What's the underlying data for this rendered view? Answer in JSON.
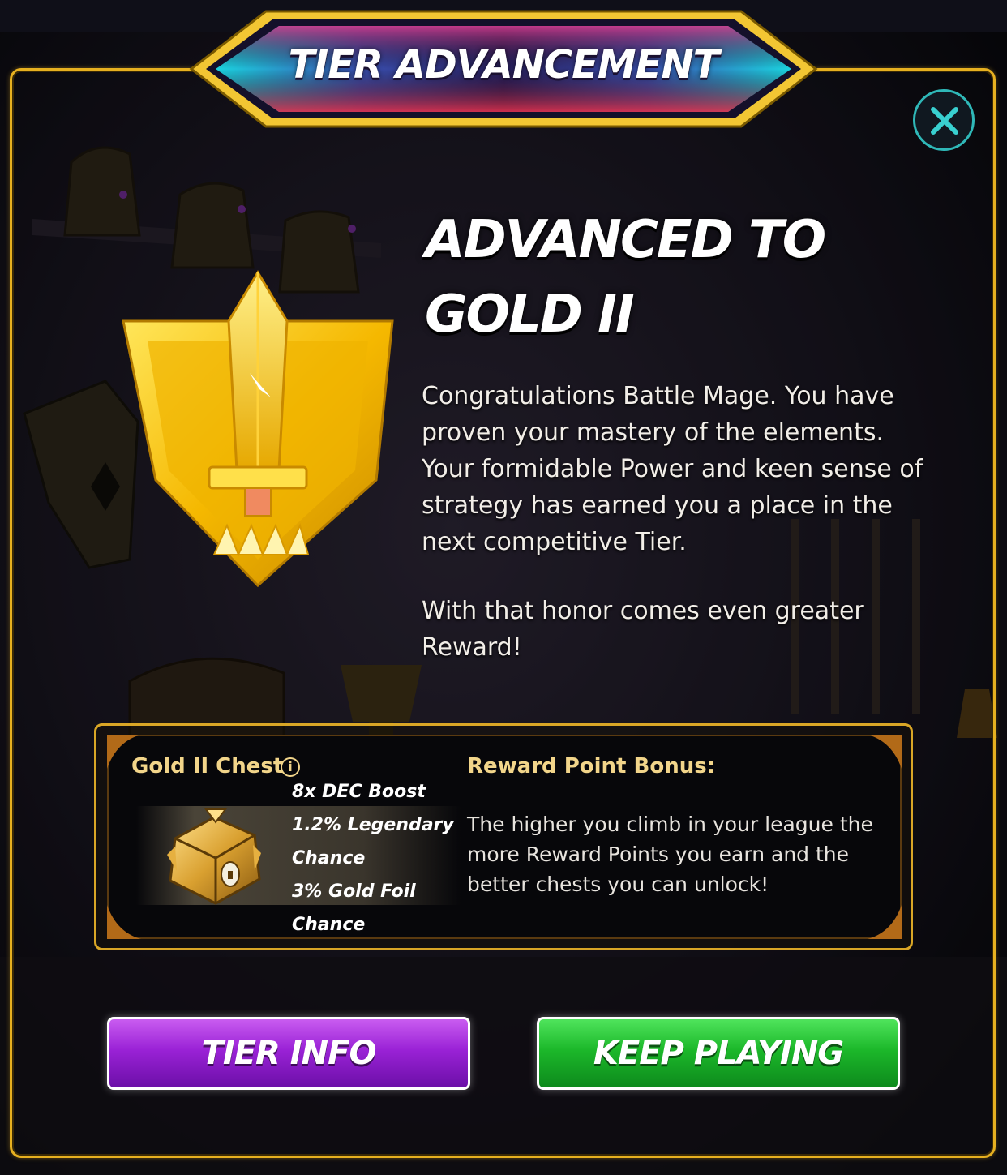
{
  "header": {
    "title": "TIER ADVANCEMENT"
  },
  "close": {
    "icon": "close-icon"
  },
  "heading": {
    "line1": "ADVANCED TO",
    "line2": "GOLD II"
  },
  "message": {
    "paragraph1": "Congratulations Battle Mage. You have proven your mastery of the elements. Your formidable Power and keen sense of strategy has earned you a place in the next competitive Tier.",
    "paragraph2": "With that honor comes even greater Reward!"
  },
  "badge": {
    "icon": "gold-tier-sword-shield-icon"
  },
  "reward": {
    "chest_label": "Gold II Chest",
    "info_icon": "info-icon",
    "chest_icon": "gold-chest-icon",
    "perks": [
      "8x DEC Boost",
      "1.2% Legendary",
      "Chance",
      "3% Gold Foil",
      "Chance"
    ],
    "bonus_title": "Reward Point Bonus:",
    "bonus_text": "The higher you climb in your league the more Reward Points you earn and the better chests you can unlock!"
  },
  "buttons": {
    "tier_info": "TIER INFO",
    "keep_playing": "KEEP PLAYING"
  },
  "colors": {
    "gold": "#e6b020",
    "purple": "#9a22d6",
    "green": "#1cb82a",
    "teal": "#2fb8b8"
  }
}
